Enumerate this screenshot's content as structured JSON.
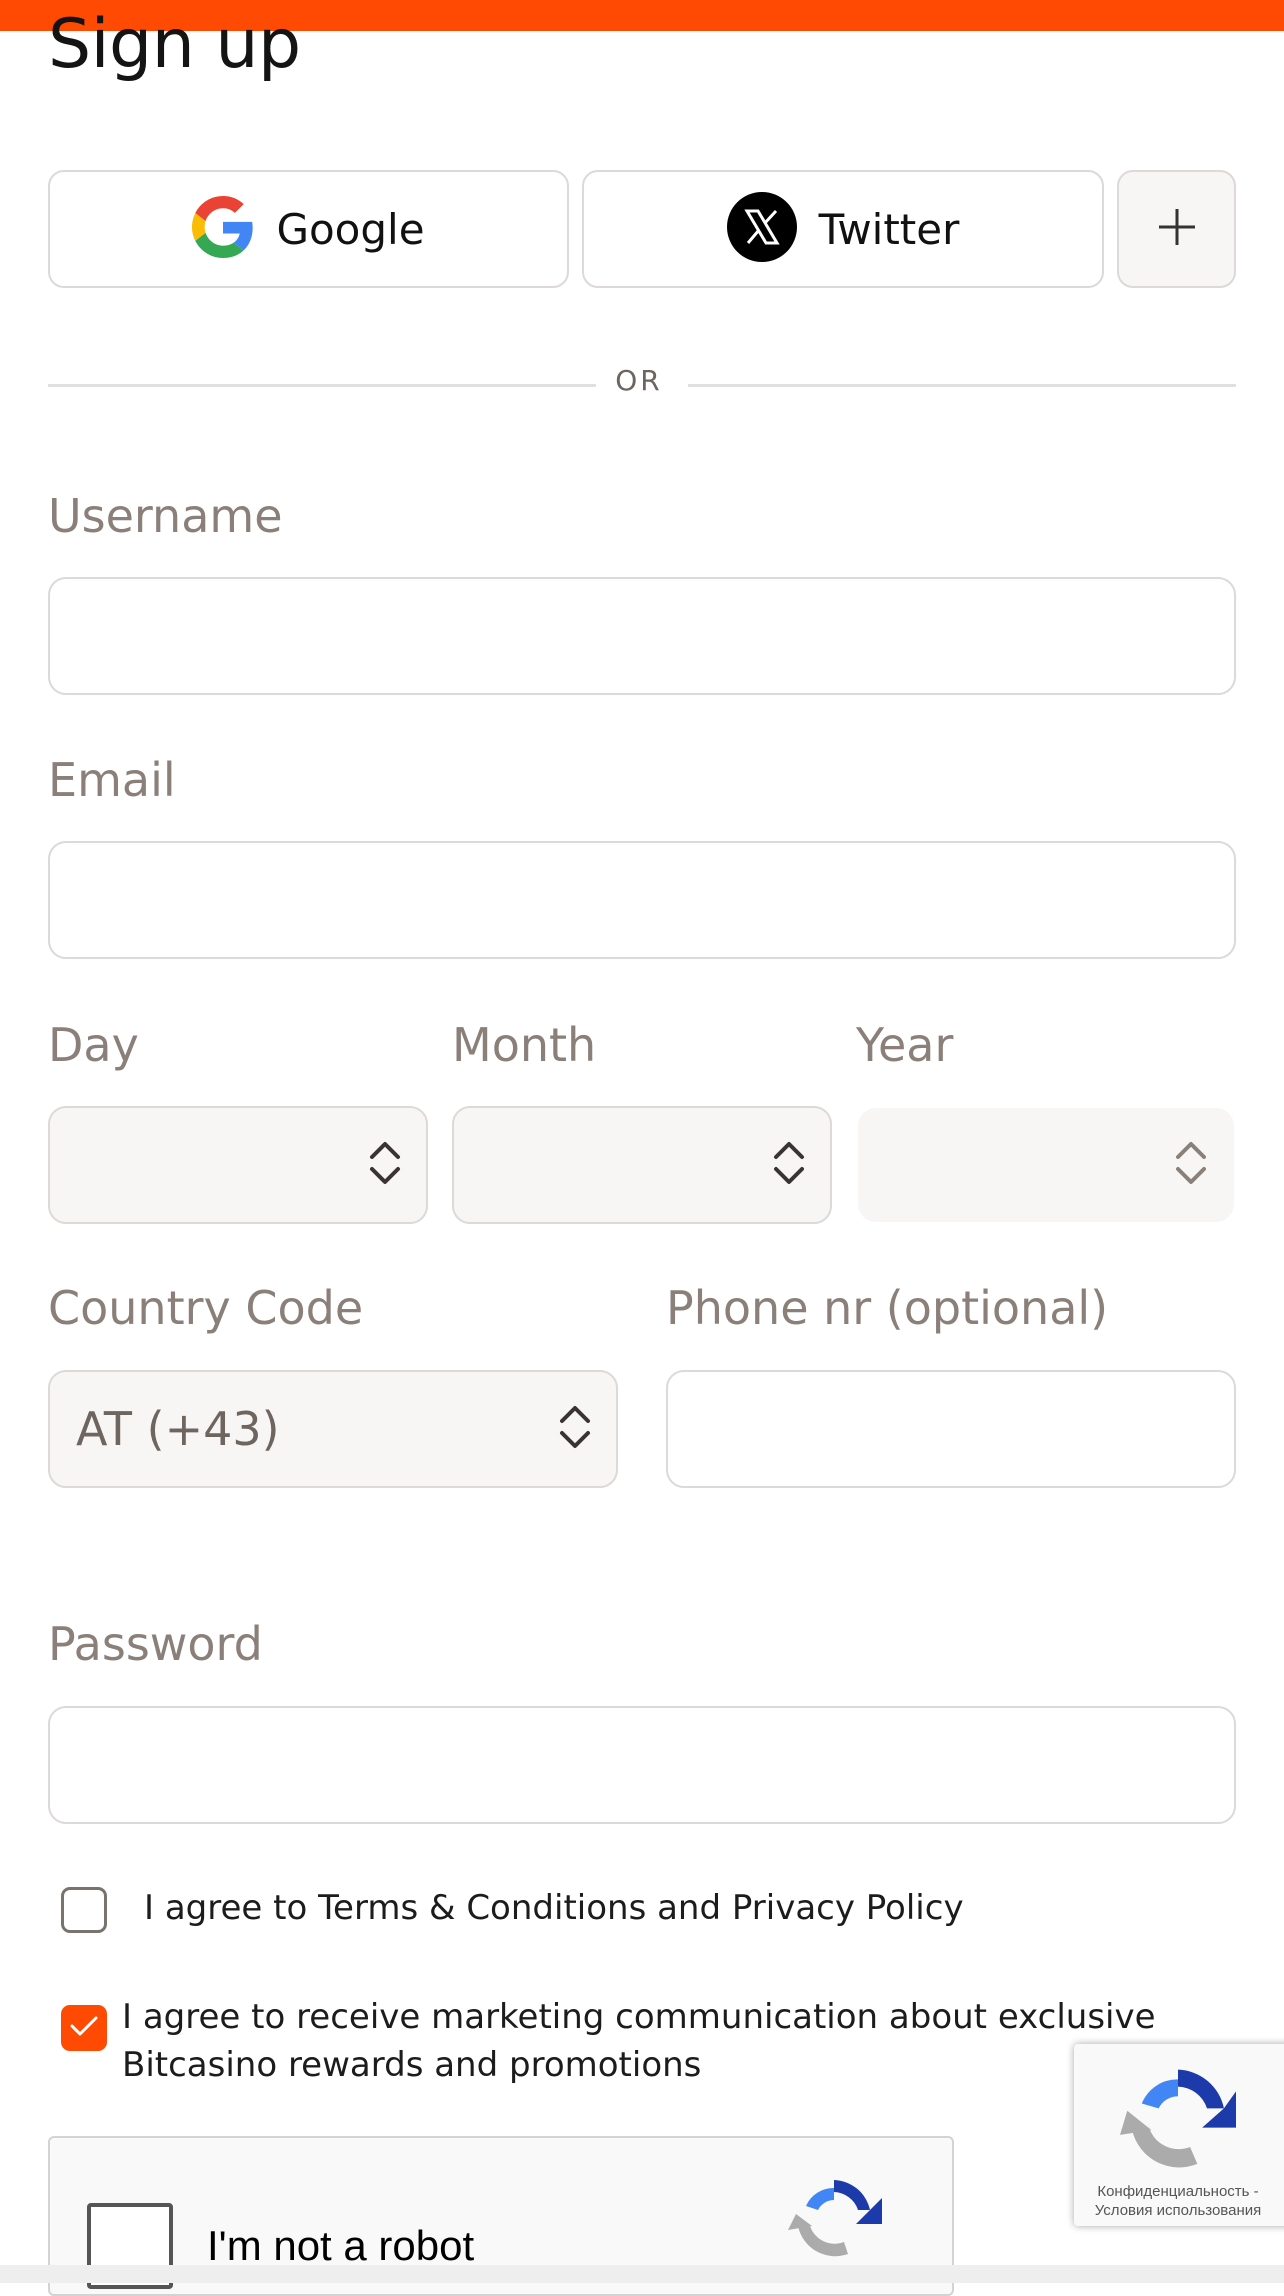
{
  "page": {
    "title": "Sign up",
    "accent_color": "#ff4a04"
  },
  "social": {
    "google_label": "Google",
    "twitter_label": "Twitter",
    "more_icon": "plus-icon"
  },
  "divider": {
    "text": "OR"
  },
  "form": {
    "username": {
      "label": "Username",
      "value": ""
    },
    "email": {
      "label": "Email",
      "value": ""
    },
    "day": {
      "label": "Day",
      "value": ""
    },
    "month": {
      "label": "Month",
      "value": ""
    },
    "year": {
      "label": "Year",
      "value": ""
    },
    "country_code": {
      "label": "Country Code",
      "value": "AT (+43)"
    },
    "phone": {
      "label": "Phone nr (optional)",
      "value": ""
    },
    "password": {
      "label": "Password",
      "value": ""
    }
  },
  "agreements": {
    "terms": {
      "text": "I agree to Terms & Conditions and Privacy Policy",
      "checked": false
    },
    "marketing": {
      "line1": "I agree to receive marketing communication about exclusive",
      "line2": "Bitcasino rewards and promotions",
      "checked": true
    }
  },
  "recaptcha": {
    "label": "I'm not a robot",
    "badge_line1": "Конфиденциальность -",
    "badge_line2": "Условия использования"
  }
}
